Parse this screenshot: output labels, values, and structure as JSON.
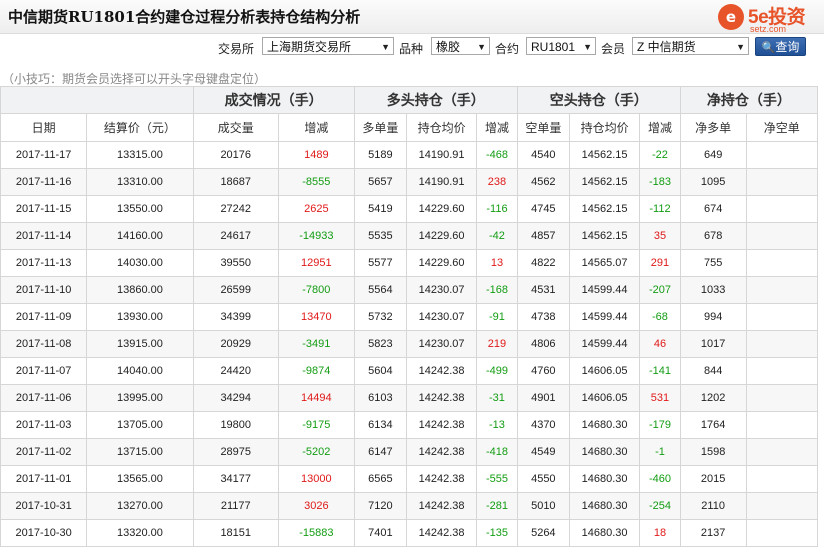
{
  "page": {
    "title": "中信期货RU1801合约建仓过程分析表持仓结构分析"
  },
  "logo": {
    "circle_text": "e",
    "main": "5e投资",
    "sub": "setz.com"
  },
  "filters": {
    "exchange_label": "交易所",
    "exchange_value": "上海期货交易所",
    "variety_label": "品种",
    "variety_value": "橡胶",
    "contract_label": "合约",
    "contract_value": "RU1801",
    "member_label": "会员",
    "member_value": "Z 中信期货",
    "query_label": "查询"
  },
  "tip": "（小技巧：期货会员选择可以开头字母键盘定位）",
  "table": {
    "groups": [
      "成交情况（手）",
      "多头持仓（手）",
      "空头持仓（手）",
      "净持仓（手）"
    ],
    "columns": [
      "日期",
      "结算价（元）",
      "成交量",
      "增减",
      "多单量",
      "持仓均价",
      "增减",
      "空单量",
      "持仓均价",
      "增减",
      "净多单",
      "净空单"
    ],
    "rows": [
      [
        "2017-11-17",
        "13315.00",
        "20176",
        "1489",
        "5189",
        "14190.91",
        "-468",
        "4540",
        "14562.15",
        "-22",
        "649",
        ""
      ],
      [
        "2017-11-16",
        "13310.00",
        "18687",
        "-8555",
        "5657",
        "14190.91",
        "238",
        "4562",
        "14562.15",
        "-183",
        "1095",
        ""
      ],
      [
        "2017-11-15",
        "13550.00",
        "27242",
        "2625",
        "5419",
        "14229.60",
        "-116",
        "4745",
        "14562.15",
        "-112",
        "674",
        ""
      ],
      [
        "2017-11-14",
        "14160.00",
        "24617",
        "-14933",
        "5535",
        "14229.60",
        "-42",
        "4857",
        "14562.15",
        "35",
        "678",
        ""
      ],
      [
        "2017-11-13",
        "14030.00",
        "39550",
        "12951",
        "5577",
        "14229.60",
        "13",
        "4822",
        "14565.07",
        "291",
        "755",
        ""
      ],
      [
        "2017-11-10",
        "13860.00",
        "26599",
        "-7800",
        "5564",
        "14230.07",
        "-168",
        "4531",
        "14599.44",
        "-207",
        "1033",
        ""
      ],
      [
        "2017-11-09",
        "13930.00",
        "34399",
        "13470",
        "5732",
        "14230.07",
        "-91",
        "4738",
        "14599.44",
        "-68",
        "994",
        ""
      ],
      [
        "2017-11-08",
        "13915.00",
        "20929",
        "-3491",
        "5823",
        "14230.07",
        "219",
        "4806",
        "14599.44",
        "46",
        "1017",
        ""
      ],
      [
        "2017-11-07",
        "14040.00",
        "24420",
        "-9874",
        "5604",
        "14242.38",
        "-499",
        "4760",
        "14606.05",
        "-141",
        "844",
        ""
      ],
      [
        "2017-11-06",
        "13995.00",
        "34294",
        "14494",
        "6103",
        "14242.38",
        "-31",
        "4901",
        "14606.05",
        "531",
        "1202",
        ""
      ],
      [
        "2017-11-03",
        "13705.00",
        "19800",
        "-9175",
        "6134",
        "14242.38",
        "-13",
        "4370",
        "14680.30",
        "-179",
        "1764",
        ""
      ],
      [
        "2017-11-02",
        "13715.00",
        "28975",
        "-5202",
        "6147",
        "14242.38",
        "-418",
        "4549",
        "14680.30",
        "-1",
        "1598",
        ""
      ],
      [
        "2017-11-01",
        "13565.00",
        "34177",
        "13000",
        "6565",
        "14242.38",
        "-555",
        "4550",
        "14680.30",
        "-460",
        "2015",
        ""
      ],
      [
        "2017-10-31",
        "13270.00",
        "21177",
        "3026",
        "7120",
        "14242.38",
        "-281",
        "5010",
        "14680.30",
        "-254",
        "2110",
        ""
      ],
      [
        "2017-10-30",
        "13320.00",
        "18151",
        "-15883",
        "7401",
        "14242.38",
        "-135",
        "5264",
        "14680.30",
        "18",
        "2137",
        ""
      ]
    ]
  },
  "colors": {
    "positive": "#e01919",
    "negative": "#139d13",
    "button": "#1f4f95",
    "brand": "#e8542a"
  }
}
